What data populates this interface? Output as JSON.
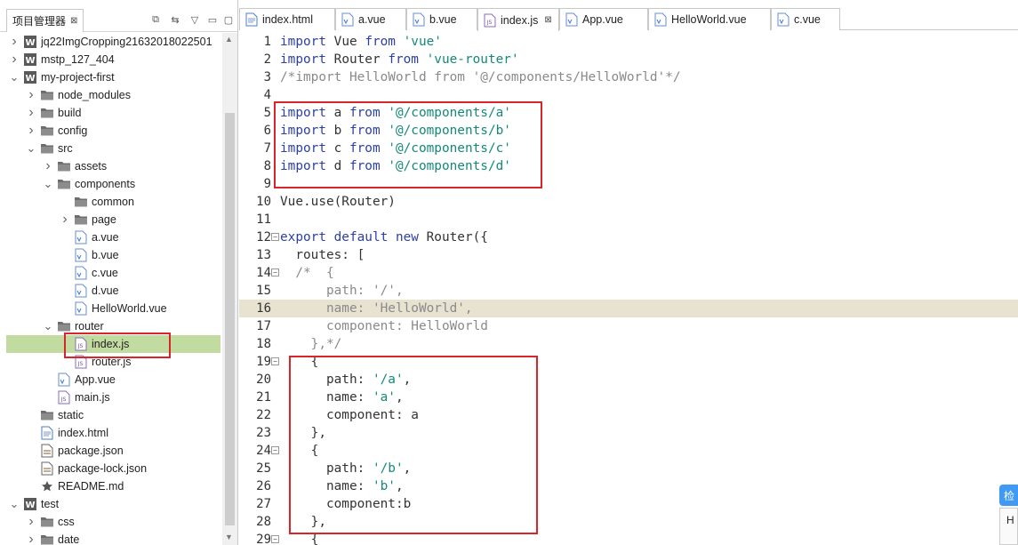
{
  "left_panel": {
    "title": "项目管理器",
    "tree": [
      {
        "label": "jq22ImgCropping21632018022501",
        "depth": 0,
        "twisty": "right",
        "icon": "project-icon"
      },
      {
        "label": "mstp_127_404",
        "depth": 0,
        "twisty": "right",
        "icon": "project-icon"
      },
      {
        "label": "my-project-first",
        "depth": 0,
        "twisty": "down",
        "icon": "project-icon"
      },
      {
        "label": "node_modules",
        "depth": 1,
        "twisty": "right",
        "icon": "folder-icon"
      },
      {
        "label": "build",
        "depth": 1,
        "twisty": "right",
        "icon": "folder-icon"
      },
      {
        "label": "config",
        "depth": 1,
        "twisty": "right",
        "icon": "folder-icon"
      },
      {
        "label": "src",
        "depth": 1,
        "twisty": "down",
        "icon": "folder-icon"
      },
      {
        "label": "assets",
        "depth": 2,
        "twisty": "right",
        "icon": "folder-icon"
      },
      {
        "label": "components",
        "depth": 2,
        "twisty": "down",
        "icon": "folder-icon"
      },
      {
        "label": "common",
        "depth": 3,
        "twisty": "",
        "icon": "folder-icon"
      },
      {
        "label": "page",
        "depth": 3,
        "twisty": "right",
        "icon": "folder-icon"
      },
      {
        "label": "a.vue",
        "depth": 3,
        "twisty": "",
        "icon": "vue-file-icon"
      },
      {
        "label": "b.vue",
        "depth": 3,
        "twisty": "",
        "icon": "vue-file-icon"
      },
      {
        "label": "c.vue",
        "depth": 3,
        "twisty": "",
        "icon": "vue-file-icon"
      },
      {
        "label": "d.vue",
        "depth": 3,
        "twisty": "",
        "icon": "vue-file-icon"
      },
      {
        "label": "HelloWorld.vue",
        "depth": 3,
        "twisty": "",
        "icon": "vue-file-icon"
      },
      {
        "label": "router",
        "depth": 2,
        "twisty": "down",
        "icon": "folder-icon"
      },
      {
        "label": "index.js",
        "depth": 3,
        "twisty": "",
        "icon": "js-file-icon",
        "selected": true
      },
      {
        "label": "router.js",
        "depth": 3,
        "twisty": "",
        "icon": "js-file-icon"
      },
      {
        "label": "App.vue",
        "depth": 2,
        "twisty": "",
        "icon": "vue-file-icon"
      },
      {
        "label": "main.js",
        "depth": 2,
        "twisty": "",
        "icon": "js-file-icon"
      },
      {
        "label": "static",
        "depth": 1,
        "twisty": "",
        "icon": "folder-icon"
      },
      {
        "label": "index.html",
        "depth": 1,
        "twisty": "",
        "icon": "html-file-icon"
      },
      {
        "label": "package.json",
        "depth": 1,
        "twisty": "",
        "icon": "json-file-icon"
      },
      {
        "label": "package-lock.json",
        "depth": 1,
        "twisty": "",
        "icon": "json-file-icon"
      },
      {
        "label": "README.md",
        "depth": 1,
        "twisty": "",
        "icon": "star-icon"
      },
      {
        "label": "test",
        "depth": 0,
        "twisty": "down",
        "icon": "project-icon"
      },
      {
        "label": "css",
        "depth": 1,
        "twisty": "right",
        "icon": "folder-icon"
      },
      {
        "label": "date",
        "depth": 1,
        "twisty": "right",
        "icon": "folder-icon"
      }
    ]
  },
  "editor": {
    "tabs": [
      {
        "label": "index.html",
        "icon": "html-file-icon"
      },
      {
        "label": "a.vue",
        "icon": "vue-file-icon"
      },
      {
        "label": "b.vue",
        "icon": "vue-file-icon"
      },
      {
        "label": "index.js",
        "icon": "js-file-icon",
        "active": true,
        "closable": true
      },
      {
        "label": "App.vue",
        "icon": "vue-file-icon"
      },
      {
        "label": "HelloWorld.vue",
        "icon": "vue-file-icon"
      },
      {
        "label": "c.vue",
        "icon": "vue-file-icon"
      }
    ],
    "lines": [
      {
        "n": "1",
        "segs": [
          [
            "kw",
            "import"
          ],
          [
            "",
            "Vue "
          ],
          [
            "kw",
            "from"
          ],
          [
            "",
            "' "
          ],
          [
            "str",
            "'vue'"
          ]
        ]
      },
      {
        "n": "2",
        "segs": [
          [
            "kw",
            "import"
          ],
          [
            "",
            "Router "
          ],
          [
            "kw",
            "from"
          ],
          [
            "str",
            "'vue-router'"
          ]
        ]
      },
      {
        "n": "3",
        "segs": [
          [
            "cmt",
            "/*import HelloWorld from '@/components/HelloWorld'*/"
          ]
        ]
      },
      {
        "n": "4",
        "segs": []
      },
      {
        "n": "5",
        "segs": [
          [
            "kw",
            "import"
          ],
          [
            "",
            "a "
          ],
          [
            "kw",
            "from"
          ],
          [
            "str",
            "'@/components/a'"
          ]
        ]
      },
      {
        "n": "6",
        "segs": [
          [
            "kw",
            "import"
          ],
          [
            "",
            "b "
          ],
          [
            "kw",
            "from"
          ],
          [
            "str",
            "'@/components/b'"
          ]
        ]
      },
      {
        "n": "7",
        "segs": [
          [
            "kw",
            "import"
          ],
          [
            "",
            "c "
          ],
          [
            "kw",
            "from"
          ],
          [
            "str",
            "'@/components/c'"
          ]
        ]
      },
      {
        "n": "8",
        "segs": [
          [
            "kw",
            "import"
          ],
          [
            "",
            "d "
          ],
          [
            "kw",
            "from"
          ],
          [
            "str",
            "'@/components/d'"
          ]
        ]
      },
      {
        "n": "9",
        "segs": []
      },
      {
        "n": "10",
        "segs": [
          [
            "",
            "Vue.use(Router)"
          ]
        ]
      },
      {
        "n": "11",
        "segs": []
      },
      {
        "n": "12",
        "fold": true,
        "segs": [
          [
            "kw",
            "export default new "
          ],
          [
            "",
            "Router({"
          ]
        ]
      },
      {
        "n": "13",
        "segs": [
          [
            "",
            "  routes: ["
          ]
        ]
      },
      {
        "n": "14",
        "fold": true,
        "segs": [
          [
            "cmt",
            "  /*  {"
          ]
        ]
      },
      {
        "n": "15",
        "segs": [
          [
            "cmt",
            "      path: '/',"
          ]
        ]
      },
      {
        "n": "16",
        "hl": true,
        "segs": [
          [
            "cmt",
            "      name: 'HelloWorld',"
          ]
        ]
      },
      {
        "n": "17",
        "segs": [
          [
            "cmt",
            "      component: HelloWorld"
          ]
        ]
      },
      {
        "n": "18",
        "segs": [
          [
            "cmt",
            "    },*/"
          ]
        ]
      },
      {
        "n": "19",
        "fold": true,
        "segs": [
          [
            "",
            "    {"
          ]
        ]
      },
      {
        "n": "20",
        "segs": [
          [
            "",
            "      path: "
          ],
          [
            "str",
            "'/a'"
          ],
          [
            "",
            ","
          ]
        ]
      },
      {
        "n": "21",
        "segs": [
          [
            "",
            "      name: "
          ],
          [
            "str",
            "'a'"
          ],
          [
            "",
            ","
          ]
        ]
      },
      {
        "n": "22",
        "segs": [
          [
            "",
            "      component: a"
          ]
        ]
      },
      {
        "n": "23",
        "segs": [
          [
            "",
            "    },"
          ]
        ]
      },
      {
        "n": "24",
        "fold": true,
        "segs": [
          [
            "",
            "    {"
          ]
        ]
      },
      {
        "n": "25",
        "segs": [
          [
            "",
            "      path: "
          ],
          [
            "str",
            "'/b'"
          ],
          [
            "",
            ","
          ]
        ]
      },
      {
        "n": "26",
        "segs": [
          [
            "",
            "      name: "
          ],
          [
            "str",
            "'b'"
          ],
          [
            "",
            ","
          ]
        ]
      },
      {
        "n": "27",
        "segs": [
          [
            "",
            "      component:b"
          ]
        ]
      },
      {
        "n": "28",
        "segs": [
          [
            "",
            "    },"
          ]
        ]
      },
      {
        "n": "29",
        "fold": true,
        "segs": [
          [
            "",
            "    {"
          ]
        ]
      }
    ]
  },
  "side_widget": {
    "button": "检",
    "text": "H"
  },
  "colors": {
    "selection": "#c2dba0",
    "highlight_line": "#e8e2d0",
    "keyword": "#2c3fa8",
    "string": "#138a79",
    "comment": "#8a8a8a",
    "annotation_box": "#d9242a"
  }
}
